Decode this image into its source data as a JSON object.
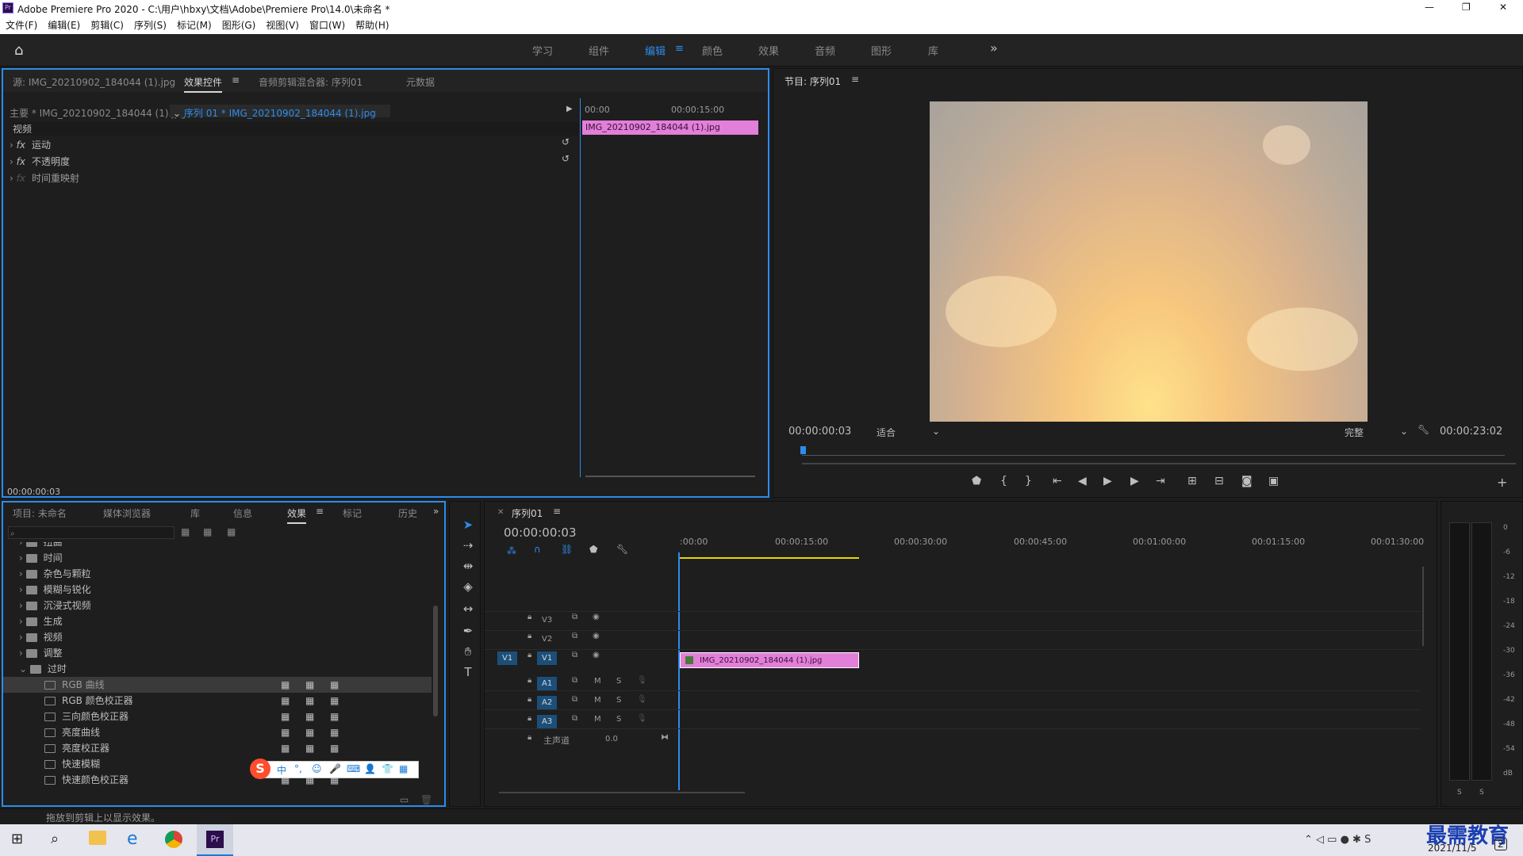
{
  "titlebar": {
    "title": "Adobe Premiere Pro 2020 - C:\\用户\\hbxy\\文档\\Adobe\\Premiere Pro\\14.0\\未命名 *",
    "minimize": "—",
    "restore": "❐",
    "close": "✕"
  },
  "menus": [
    "文件(F)",
    "编辑(E)",
    "剪辑(C)",
    "序列(S)",
    "标记(M)",
    "图形(G)",
    "视图(V)",
    "窗口(W)",
    "帮助(H)"
  ],
  "workspaces": [
    "学习",
    "组件",
    "编辑",
    "颜色",
    "效果",
    "音频",
    "图形",
    "库"
  ],
  "workspace_active": "编辑",
  "workspace_more": "»",
  "source_panel": {
    "tabs": [
      "源: IMG_20210902_184044 (1).jpg",
      "效果控件",
      "音频剪辑混合器: 序列01",
      "元数据"
    ],
    "master": "主要 * IMG_20210902_184044 (1).jpg",
    "sequence_clip": "序列 01 * IMG_20210902_184044 (1).jpg",
    "section": "视频",
    "rows": [
      "运动",
      "不透明度",
      "时间重映射"
    ],
    "fx": "fx",
    "ruler": [
      "00:00",
      "00:00:15:00"
    ],
    "clip": "IMG_20210902_184044 (1).jpg",
    "timecode": "00:00:00:03"
  },
  "program_panel": {
    "title": "节目: 序列01",
    "timecode": "00:00:00:03",
    "fit": "适合",
    "quality": "完整",
    "duration": "00:00:23:02"
  },
  "project_panel": {
    "tabs": [
      "项目: 未命名",
      "媒体浏览器",
      "库",
      "信息",
      "效果",
      "标记",
      "历史"
    ],
    "items": [
      {
        "label": "扭曲",
        "type": "folder"
      },
      {
        "label": "时间",
        "type": "folder"
      },
      {
        "label": "杂色与颗粒",
        "type": "folder"
      },
      {
        "label": "模糊与锐化",
        "type": "folder"
      },
      {
        "label": "沉浸式视频",
        "type": "folder"
      },
      {
        "label": "生成",
        "type": "folder"
      },
      {
        "label": "视频",
        "type": "folder"
      },
      {
        "label": "调整",
        "type": "folder"
      },
      {
        "label": "过时",
        "type": "folder-open"
      },
      {
        "label": "RGB 曲线",
        "type": "effect",
        "selected": true
      },
      {
        "label": "RGB 颜色校正器",
        "type": "effect"
      },
      {
        "label": "三向颜色校正器",
        "type": "effect"
      },
      {
        "label": "亮度曲线",
        "type": "effect"
      },
      {
        "label": "亮度校正器",
        "type": "effect"
      },
      {
        "label": "快速模糊",
        "type": "effect"
      },
      {
        "label": "快速颜色校正器",
        "type": "effect"
      }
    ],
    "ime": [
      "中",
      "°,",
      "☺",
      "🎤",
      "⌨",
      "👤",
      "👕",
      "▦"
    ]
  },
  "timeline": {
    "title": "序列01",
    "timecode": "00:00:00:03",
    "ruler": [
      ":00:00",
      "00:00:15:00",
      "00:00:30:00",
      "00:00:45:00",
      "00:01:00:00",
      "00:01:15:00",
      "00:01:30:00"
    ],
    "video_tracks": [
      "V3",
      "V2",
      "V1"
    ],
    "audio_tracks": [
      "A1",
      "A2",
      "A3"
    ],
    "src_v": "V1",
    "mute": "M",
    "solo": "S",
    "master": "主声道",
    "master_val": "0.0",
    "clip": "IMG_20210902_184044 (1).jpg"
  },
  "meter": {
    "scale": [
      "0",
      "-6",
      "-12",
      "-18",
      "-24",
      "-30",
      "-36",
      "-42",
      "-48",
      "-54",
      "dB"
    ],
    "solo": [
      "S",
      "S"
    ]
  },
  "status": "拖放到剪辑上以显示效果。",
  "taskbar": {
    "clock_date": "2021/11/5",
    "watermark": "最需教育",
    "notif": "2"
  },
  "colors": {
    "accent": "#2d8ceb",
    "clip": "#e27fd8",
    "workarea": "#e4d700"
  }
}
